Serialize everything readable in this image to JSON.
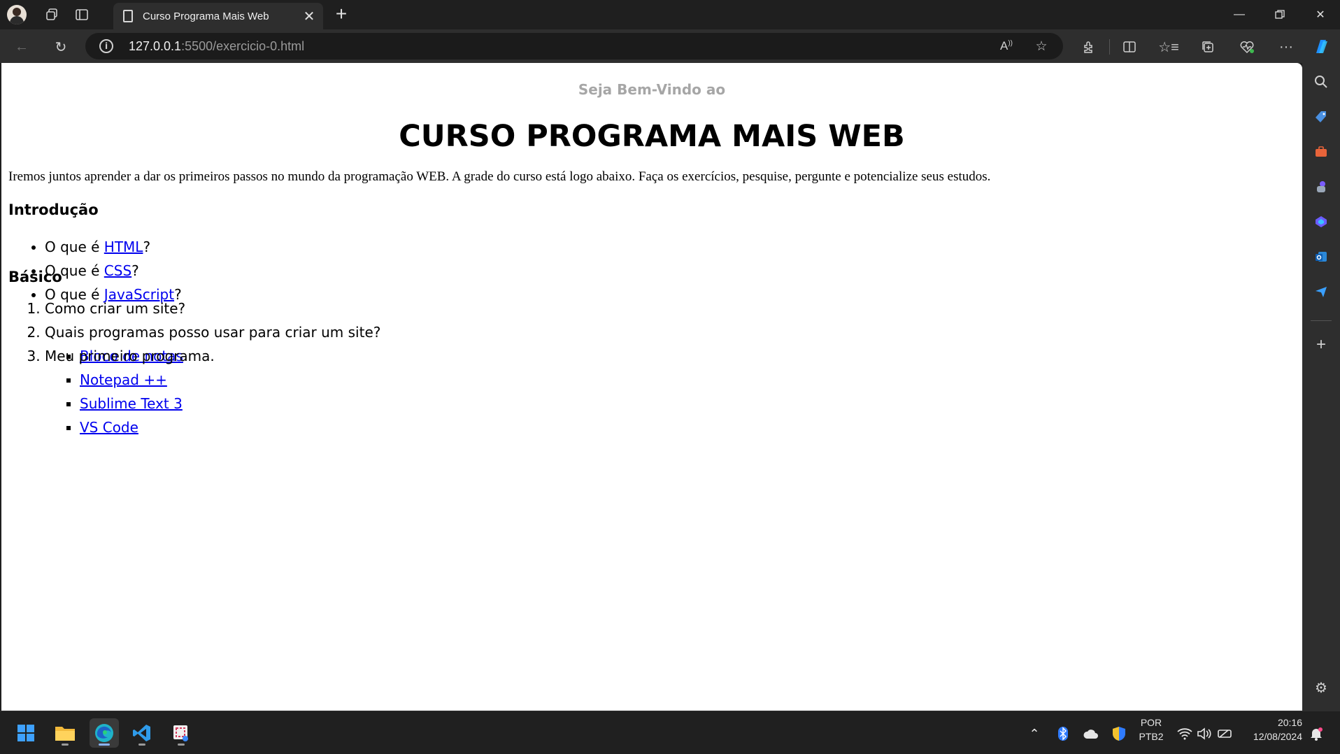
{
  "browser": {
    "tab_title": "Curso Programa Mais Web",
    "new_tab_symbol": "+",
    "url_host": "127.0.0.1",
    "url_rest": ":5500/exercicio-0.html"
  },
  "page": {
    "subheading": "Seja Bem-Vindo ao",
    "heading": "CURSO PROGRAMA MAIS WEB",
    "intro": "Iremos juntos aprender a dar os primeiros passos no mundo da programação WEB. A grade do curso está logo abaixo. Faça os exercícios, pesquise, pergunte e potencialize seus estudos.",
    "intro_section": {
      "title": "Introdução",
      "items": [
        {
          "prefix": "O que é ",
          "link": "HTML",
          "suffix": "?"
        },
        {
          "prefix": "O que é ",
          "link": "CSS",
          "suffix": "?"
        },
        {
          "prefix": "O que é ",
          "link": "JavaScript",
          "suffix": "?"
        }
      ]
    },
    "basic_section": {
      "title": "Básico",
      "item1": "Como criar um site?",
      "item2": "Quais programas posso usar para criar um site?",
      "programs": [
        "Bloco de notas",
        "Notepad ++",
        "Sublime Text 3",
        "VS Code"
      ],
      "item3": "Meu primeiro programa."
    }
  },
  "taskbar": {
    "language": "POR",
    "layout": "PTB2",
    "time": "20:16",
    "date": "12/08/2024"
  },
  "colors": {
    "link": "#0000ee",
    "subheading": "#a6a6a6",
    "edge_accent": "#1e90ff"
  }
}
